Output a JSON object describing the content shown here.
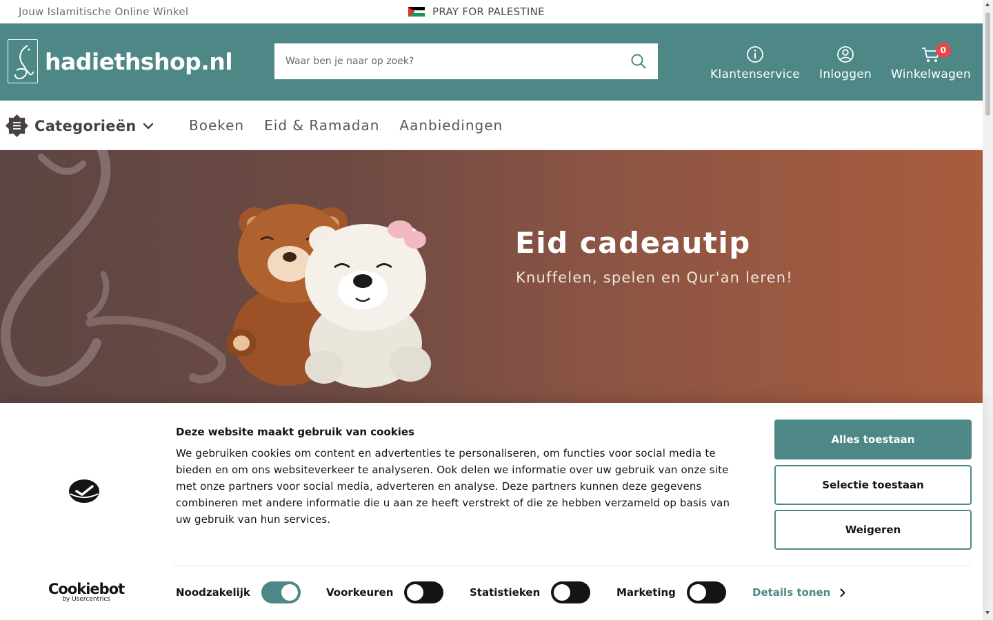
{
  "topbar": {
    "tagline": "Jouw Islamitische Online Winkel",
    "pray": "PRAY FOR PALESTINE"
  },
  "header": {
    "logo_text": "hadiethshop.nl",
    "search_placeholder": "Waar ben je naar op zoek?",
    "customer_service": "Klantenservice",
    "login": "Inloggen",
    "cart": "Winkelwagen",
    "cart_count": "0"
  },
  "nav": {
    "categories": "Categorieën",
    "links": [
      "Boeken",
      "Eid & Ramadan",
      "Aanbiedingen"
    ]
  },
  "hero": {
    "title": "Eid cadeautip",
    "subtitle": "Knuffelen, spelen en Qur'an leren!"
  },
  "cookie": {
    "title": "Deze website maakt gebruik van cookies",
    "text": "We gebruiken cookies om content en advertenties te personaliseren, om functies voor social media te bieden en om ons websiteverkeer te analyseren. Ook delen we informatie over uw gebruik van onze site met onze partners voor social media, adverteren en analyse. Deze partners kunnen deze gegevens combineren met andere informatie die u aan ze heeft verstrekt of die ze hebben verzameld op basis van uw gebruik van hun services.",
    "buttons": {
      "allow_all": "Alles toestaan",
      "allow_selection": "Selectie toestaan",
      "deny": "Weigeren"
    },
    "brand": "Cookiebot",
    "brand_sub": "by Usercentrics",
    "toggles": [
      {
        "label": "Noodzakelijk",
        "on": true
      },
      {
        "label": "Voorkeuren",
        "on": false
      },
      {
        "label": "Statistieken",
        "on": false
      },
      {
        "label": "Marketing",
        "on": false
      }
    ],
    "details": "Details tonen"
  },
  "colors": {
    "brand_teal": "#4d8887",
    "badge_red": "#e8474b",
    "hero_brown": "#8a5444"
  }
}
